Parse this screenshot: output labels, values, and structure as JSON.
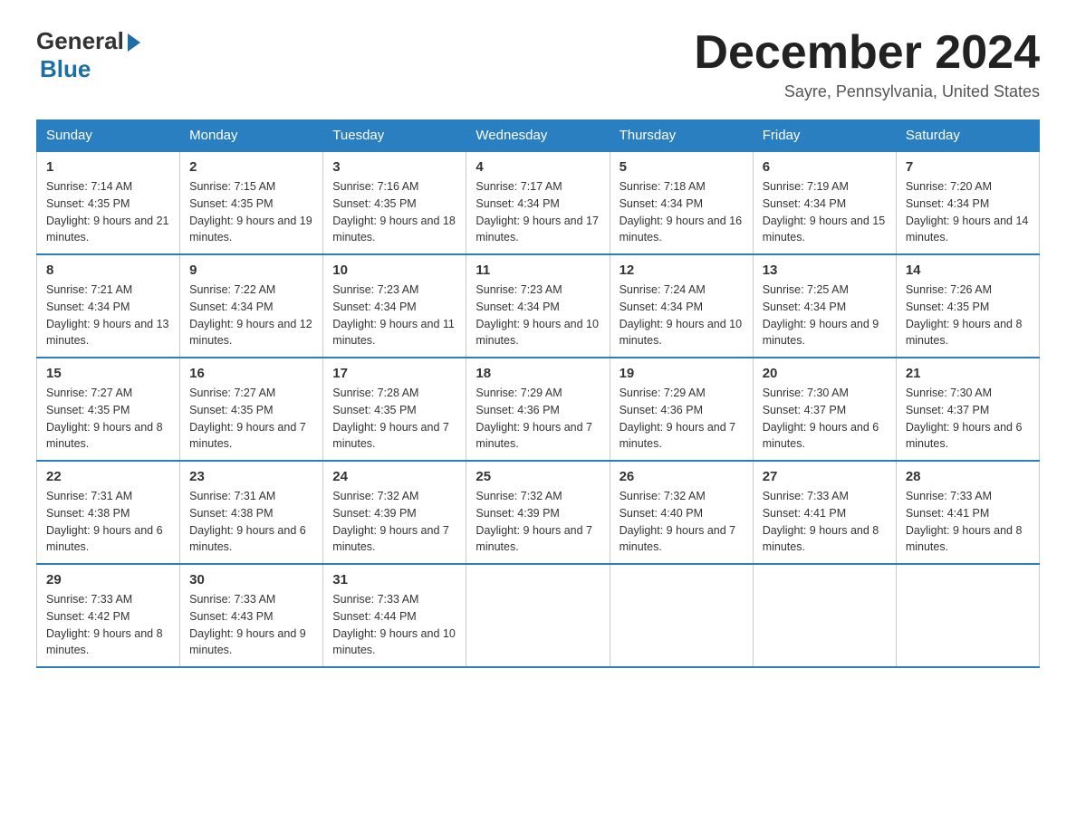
{
  "header": {
    "logo_general": "General",
    "logo_blue": "Blue",
    "month_title": "December 2024",
    "location": "Sayre, Pennsylvania, United States"
  },
  "days_of_week": [
    "Sunday",
    "Monday",
    "Tuesday",
    "Wednesday",
    "Thursday",
    "Friday",
    "Saturday"
  ],
  "weeks": [
    [
      {
        "day": "1",
        "sunrise": "7:14 AM",
        "sunset": "4:35 PM",
        "daylight": "9 hours and 21 minutes."
      },
      {
        "day": "2",
        "sunrise": "7:15 AM",
        "sunset": "4:35 PM",
        "daylight": "9 hours and 19 minutes."
      },
      {
        "day": "3",
        "sunrise": "7:16 AM",
        "sunset": "4:35 PM",
        "daylight": "9 hours and 18 minutes."
      },
      {
        "day": "4",
        "sunrise": "7:17 AM",
        "sunset": "4:34 PM",
        "daylight": "9 hours and 17 minutes."
      },
      {
        "day": "5",
        "sunrise": "7:18 AM",
        "sunset": "4:34 PM",
        "daylight": "9 hours and 16 minutes."
      },
      {
        "day": "6",
        "sunrise": "7:19 AM",
        "sunset": "4:34 PM",
        "daylight": "9 hours and 15 minutes."
      },
      {
        "day": "7",
        "sunrise": "7:20 AM",
        "sunset": "4:34 PM",
        "daylight": "9 hours and 14 minutes."
      }
    ],
    [
      {
        "day": "8",
        "sunrise": "7:21 AM",
        "sunset": "4:34 PM",
        "daylight": "9 hours and 13 minutes."
      },
      {
        "day": "9",
        "sunrise": "7:22 AM",
        "sunset": "4:34 PM",
        "daylight": "9 hours and 12 minutes."
      },
      {
        "day": "10",
        "sunrise": "7:23 AM",
        "sunset": "4:34 PM",
        "daylight": "9 hours and 11 minutes."
      },
      {
        "day": "11",
        "sunrise": "7:23 AM",
        "sunset": "4:34 PM",
        "daylight": "9 hours and 10 minutes."
      },
      {
        "day": "12",
        "sunrise": "7:24 AM",
        "sunset": "4:34 PM",
        "daylight": "9 hours and 10 minutes."
      },
      {
        "day": "13",
        "sunrise": "7:25 AM",
        "sunset": "4:34 PM",
        "daylight": "9 hours and 9 minutes."
      },
      {
        "day": "14",
        "sunrise": "7:26 AM",
        "sunset": "4:35 PM",
        "daylight": "9 hours and 8 minutes."
      }
    ],
    [
      {
        "day": "15",
        "sunrise": "7:27 AM",
        "sunset": "4:35 PM",
        "daylight": "9 hours and 8 minutes."
      },
      {
        "day": "16",
        "sunrise": "7:27 AM",
        "sunset": "4:35 PM",
        "daylight": "9 hours and 7 minutes."
      },
      {
        "day": "17",
        "sunrise": "7:28 AM",
        "sunset": "4:35 PM",
        "daylight": "9 hours and 7 minutes."
      },
      {
        "day": "18",
        "sunrise": "7:29 AM",
        "sunset": "4:36 PM",
        "daylight": "9 hours and 7 minutes."
      },
      {
        "day": "19",
        "sunrise": "7:29 AM",
        "sunset": "4:36 PM",
        "daylight": "9 hours and 7 minutes."
      },
      {
        "day": "20",
        "sunrise": "7:30 AM",
        "sunset": "4:37 PM",
        "daylight": "9 hours and 6 minutes."
      },
      {
        "day": "21",
        "sunrise": "7:30 AM",
        "sunset": "4:37 PM",
        "daylight": "9 hours and 6 minutes."
      }
    ],
    [
      {
        "day": "22",
        "sunrise": "7:31 AM",
        "sunset": "4:38 PM",
        "daylight": "9 hours and 6 minutes."
      },
      {
        "day": "23",
        "sunrise": "7:31 AM",
        "sunset": "4:38 PM",
        "daylight": "9 hours and 6 minutes."
      },
      {
        "day": "24",
        "sunrise": "7:32 AM",
        "sunset": "4:39 PM",
        "daylight": "9 hours and 7 minutes."
      },
      {
        "day": "25",
        "sunrise": "7:32 AM",
        "sunset": "4:39 PM",
        "daylight": "9 hours and 7 minutes."
      },
      {
        "day": "26",
        "sunrise": "7:32 AM",
        "sunset": "4:40 PM",
        "daylight": "9 hours and 7 minutes."
      },
      {
        "day": "27",
        "sunrise": "7:33 AM",
        "sunset": "4:41 PM",
        "daylight": "9 hours and 8 minutes."
      },
      {
        "day": "28",
        "sunrise": "7:33 AM",
        "sunset": "4:41 PM",
        "daylight": "9 hours and 8 minutes."
      }
    ],
    [
      {
        "day": "29",
        "sunrise": "7:33 AM",
        "sunset": "4:42 PM",
        "daylight": "9 hours and 8 minutes."
      },
      {
        "day": "30",
        "sunrise": "7:33 AM",
        "sunset": "4:43 PM",
        "daylight": "9 hours and 9 minutes."
      },
      {
        "day": "31",
        "sunrise": "7:33 AM",
        "sunset": "4:44 PM",
        "daylight": "9 hours and 10 minutes."
      },
      null,
      null,
      null,
      null
    ]
  ]
}
